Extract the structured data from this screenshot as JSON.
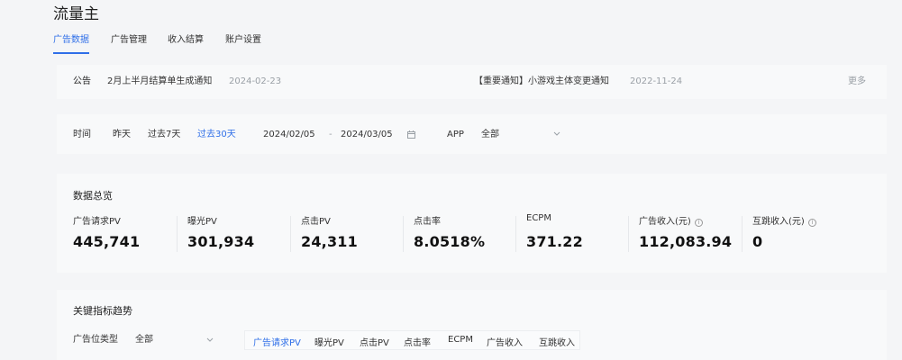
{
  "app": {
    "title": "流量主"
  },
  "nav": {
    "tabs": [
      "广告数据",
      "广告管理",
      "收入结算",
      "账户设置"
    ]
  },
  "notice": {
    "label": "公告",
    "items": [
      {
        "text": "2月上半月结算单生成通知",
        "date": "2024-02-23"
      },
      {
        "text": "【重要通知】小游戏主体变更通知",
        "date": "2022-11-24"
      }
    ],
    "more": "更多"
  },
  "filters": {
    "time_label": "时间",
    "options": [
      "昨天",
      "过去7天",
      "过去30天"
    ],
    "active_option": "过去30天",
    "start_date": "2024/02/05",
    "end_date": "2024/03/05",
    "app_label": "APP",
    "app_value": "全部"
  },
  "overview": {
    "title": "数据总览",
    "metrics": [
      {
        "label": "广告请求PV",
        "value": "445,741"
      },
      {
        "label": "曝光PV",
        "value": "301,934"
      },
      {
        "label": "点击PV",
        "value": "24,311"
      },
      {
        "label": "点击率",
        "value": "8.0518%"
      },
      {
        "label": "ECPM",
        "value": "371.22"
      },
      {
        "label": "广告收入(元)",
        "value": "112,083.94"
      },
      {
        "label": "互跳收入(元)",
        "value": "0"
      }
    ]
  },
  "trend": {
    "title": "关键指标趋势",
    "ad_type_label": "广告位类型",
    "ad_type_value": "全部",
    "metric_tabs": [
      "广告请求PV",
      "曝光PV",
      "点击PV",
      "点击率",
      "ECPM",
      "广告收入",
      "互跳收入"
    ],
    "active_metric": "广告请求PV"
  },
  "icons": {
    "calendar": "calendar-icon",
    "chevron": "chevron-down-icon",
    "info": "info-icon"
  },
  "colors": {
    "accent": "#2f6fe8",
    "background": "#f4f5f7",
    "card": "#f8f9fa"
  }
}
